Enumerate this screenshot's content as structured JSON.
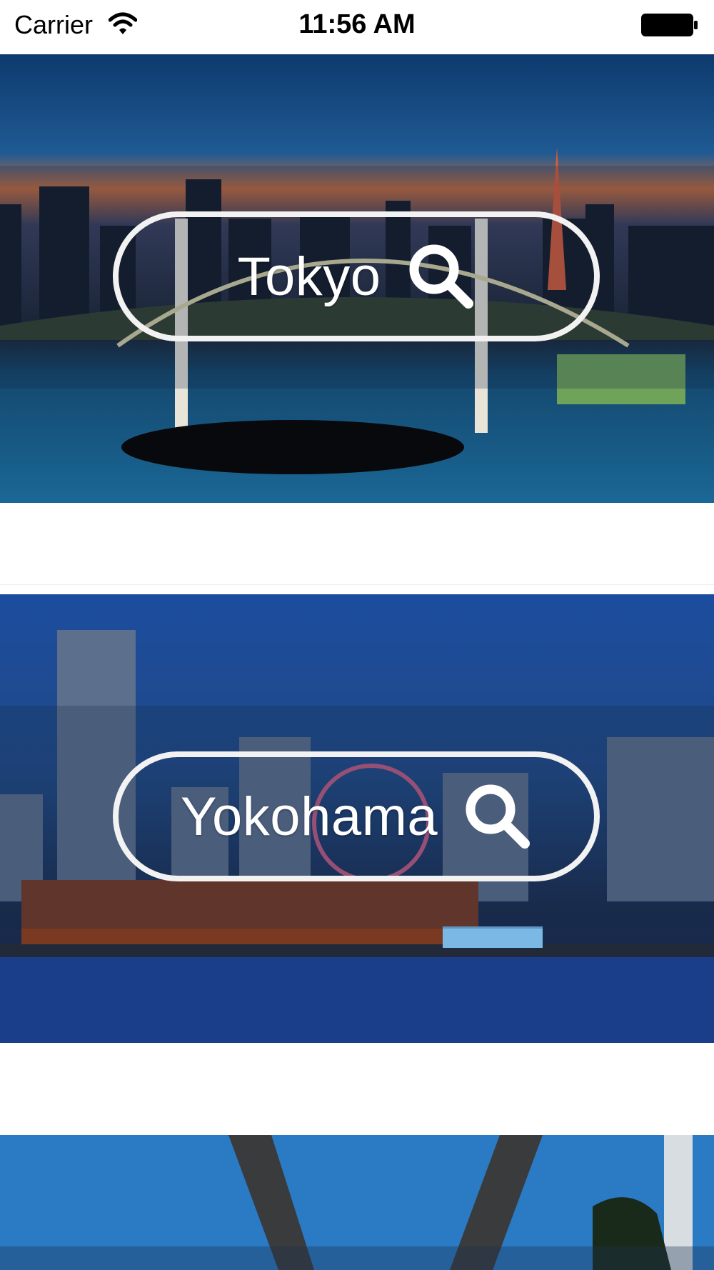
{
  "status_bar": {
    "carrier": "Carrier",
    "time": "11:56 AM",
    "icons": [
      "wifi-icon",
      "battery-icon"
    ]
  },
  "cities": [
    {
      "name": "Tokyo",
      "icon": "search-icon"
    },
    {
      "name": "Yokohama",
      "icon": "search-icon"
    }
  ],
  "colors": {
    "status_bg": "#ffffff",
    "pill_border": "#f2f2f2",
    "label": "#ffffff"
  }
}
